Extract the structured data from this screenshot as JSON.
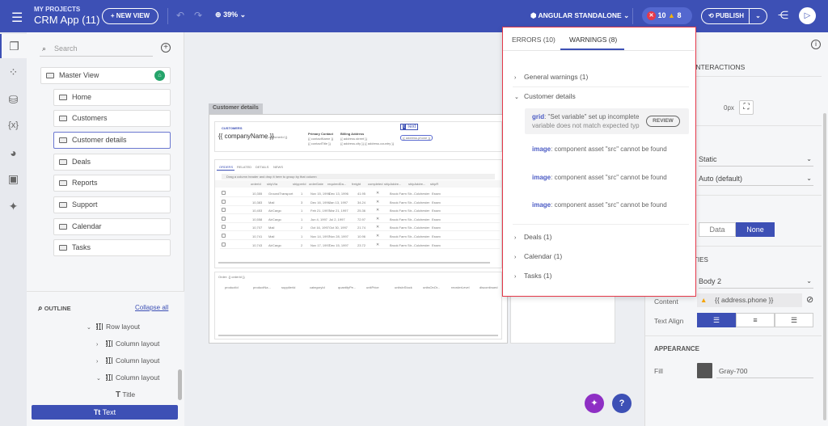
{
  "header": {
    "project_label": "MY PROJECTS",
    "app_name": "CRM App (11)",
    "new_view": "+ NEW VIEW",
    "zoom": "39%",
    "framework": "ANGULAR STANDALONE",
    "error_count": "10",
    "warning_count": "8",
    "publish": "PUBLISH"
  },
  "sidebar": {
    "search_placeholder": "Search",
    "master_view": "Master View",
    "views": [
      "Home",
      "Customers",
      "Customer details",
      "Deals",
      "Reports",
      "Support",
      "Calendar",
      "Tasks"
    ]
  },
  "outline": {
    "title": "OUTLINE",
    "collapse_all": "Collapse all",
    "items": [
      "Row layout",
      "Column layout",
      "Column layout",
      "Column layout",
      "Title",
      "Text"
    ]
  },
  "canvas": {
    "frame_title": "Customer details",
    "breadcrumb": "CUSTOMERS",
    "company": "{{ companyName }}",
    "customer_id": "{{ customerId }}",
    "primary_contact": "Primary Contact",
    "contact_name": "{{ contactName }}",
    "contact_title": "{{ contactTitle }}",
    "billing_address": "Billing Address",
    "street": "{{ address.street }}",
    "city": "{{ address.city }}",
    "country": "{{ address.country }}",
    "text_badge": "Text",
    "phone": "{{ address.phone }}",
    "tabs": [
      "ORDERS",
      "RELATED",
      "DETAILS",
      "NEWS"
    ],
    "group_hint": "Drag a column header and drop it here to group by that column",
    "columns": [
      "orderId",
      "shipVia",
      "shipperId",
      "orderDate",
      "requiredDa...",
      "freight",
      "completed",
      "shipAddre...",
      "shipAddre...",
      "shipR"
    ],
    "rows": [
      [
        "10,355",
        "GroundTransport",
        "1",
        "Nov 15, 1996",
        "Dec 13, 1996",
        "41.95",
        "Brook Farm Str...",
        "Colchester",
        "Essex"
      ],
      [
        "10,383",
        "Mail",
        "3",
        "Dec 16, 1996",
        "Jan 13, 1997",
        "34.24",
        "Brook Farm Str...",
        "Colchester",
        "Essex"
      ],
      [
        "10,453",
        "AirCargo",
        "1",
        "Feb 21, 1997",
        "Mar 21, 1997",
        "25.36",
        "Brook Farm Str...",
        "Colchester",
        "Essex"
      ],
      [
        "10,558",
        "AirCargo",
        "1",
        "Jun 4, 1997",
        "Jul 2, 1997",
        "72.97",
        "Brook Farm Str...",
        "Colchester",
        "Essex"
      ],
      [
        "10,707",
        "Mail",
        "2",
        "Oct 16, 1997",
        "Oct 30, 1997",
        "21.74",
        "Brook Farm Str...",
        "Colchester",
        "Essex"
      ],
      [
        "10,741",
        "Mail",
        "1",
        "Nov 14, 1997",
        "Nov 28, 1997",
        "10.96",
        "Brook Farm Str...",
        "Colchester",
        "Essex"
      ],
      [
        "10,743",
        "AirCargo",
        "2",
        "Nov 17, 1997",
        "Dec 15, 1997",
        "23.72",
        "Brook Farm Str...",
        "Colchester",
        "Essex"
      ]
    ],
    "order_label": "Order: {{ orderId }}",
    "detail_columns": [
      "productId",
      "productNa...",
      "supplierId",
      "categoryId",
      "quantityPe...",
      "unitPrice",
      "unitsInStock",
      "unitsOnOr...",
      "reorderLevel",
      "discontinued"
    ]
  },
  "right_panel": {
    "interactions": "INTERACTIONS",
    "px_value": "0px",
    "position": "Static",
    "size": "Auto (default)",
    "data_btn": "Data",
    "none_btn": "None",
    "properties": "TIES",
    "typography": "Body 2",
    "content_label": "Content",
    "content_value": "{{ address.phone }}",
    "text_align_label": "Text Align",
    "appearance": "APPEARANCE",
    "fill_label": "Fill",
    "fill_value": "Gray-700",
    "fill_color": "#555555"
  },
  "popup": {
    "tab_errors": "ERRORS (10)",
    "tab_warnings": "WARNINGS (8)",
    "groups": [
      "General warnings (1)",
      "Customer details",
      "Deals (1)",
      "Calendar (1)",
      "Tasks (1)"
    ],
    "warnings": [
      {
        "comp": "grid",
        "msg1": ": \"Set variable\" set up incomplete",
        "msg2": "variable does not match expected typ"
      },
      {
        "comp": "image",
        "msg1": ": component asset \"src\" cannot be found"
      },
      {
        "comp": "image",
        "msg1": ": component asset \"src\" cannot be found"
      },
      {
        "comp": "image",
        "msg1": ": component asset \"src\" cannot be found"
      }
    ],
    "review": "REVIEW"
  }
}
